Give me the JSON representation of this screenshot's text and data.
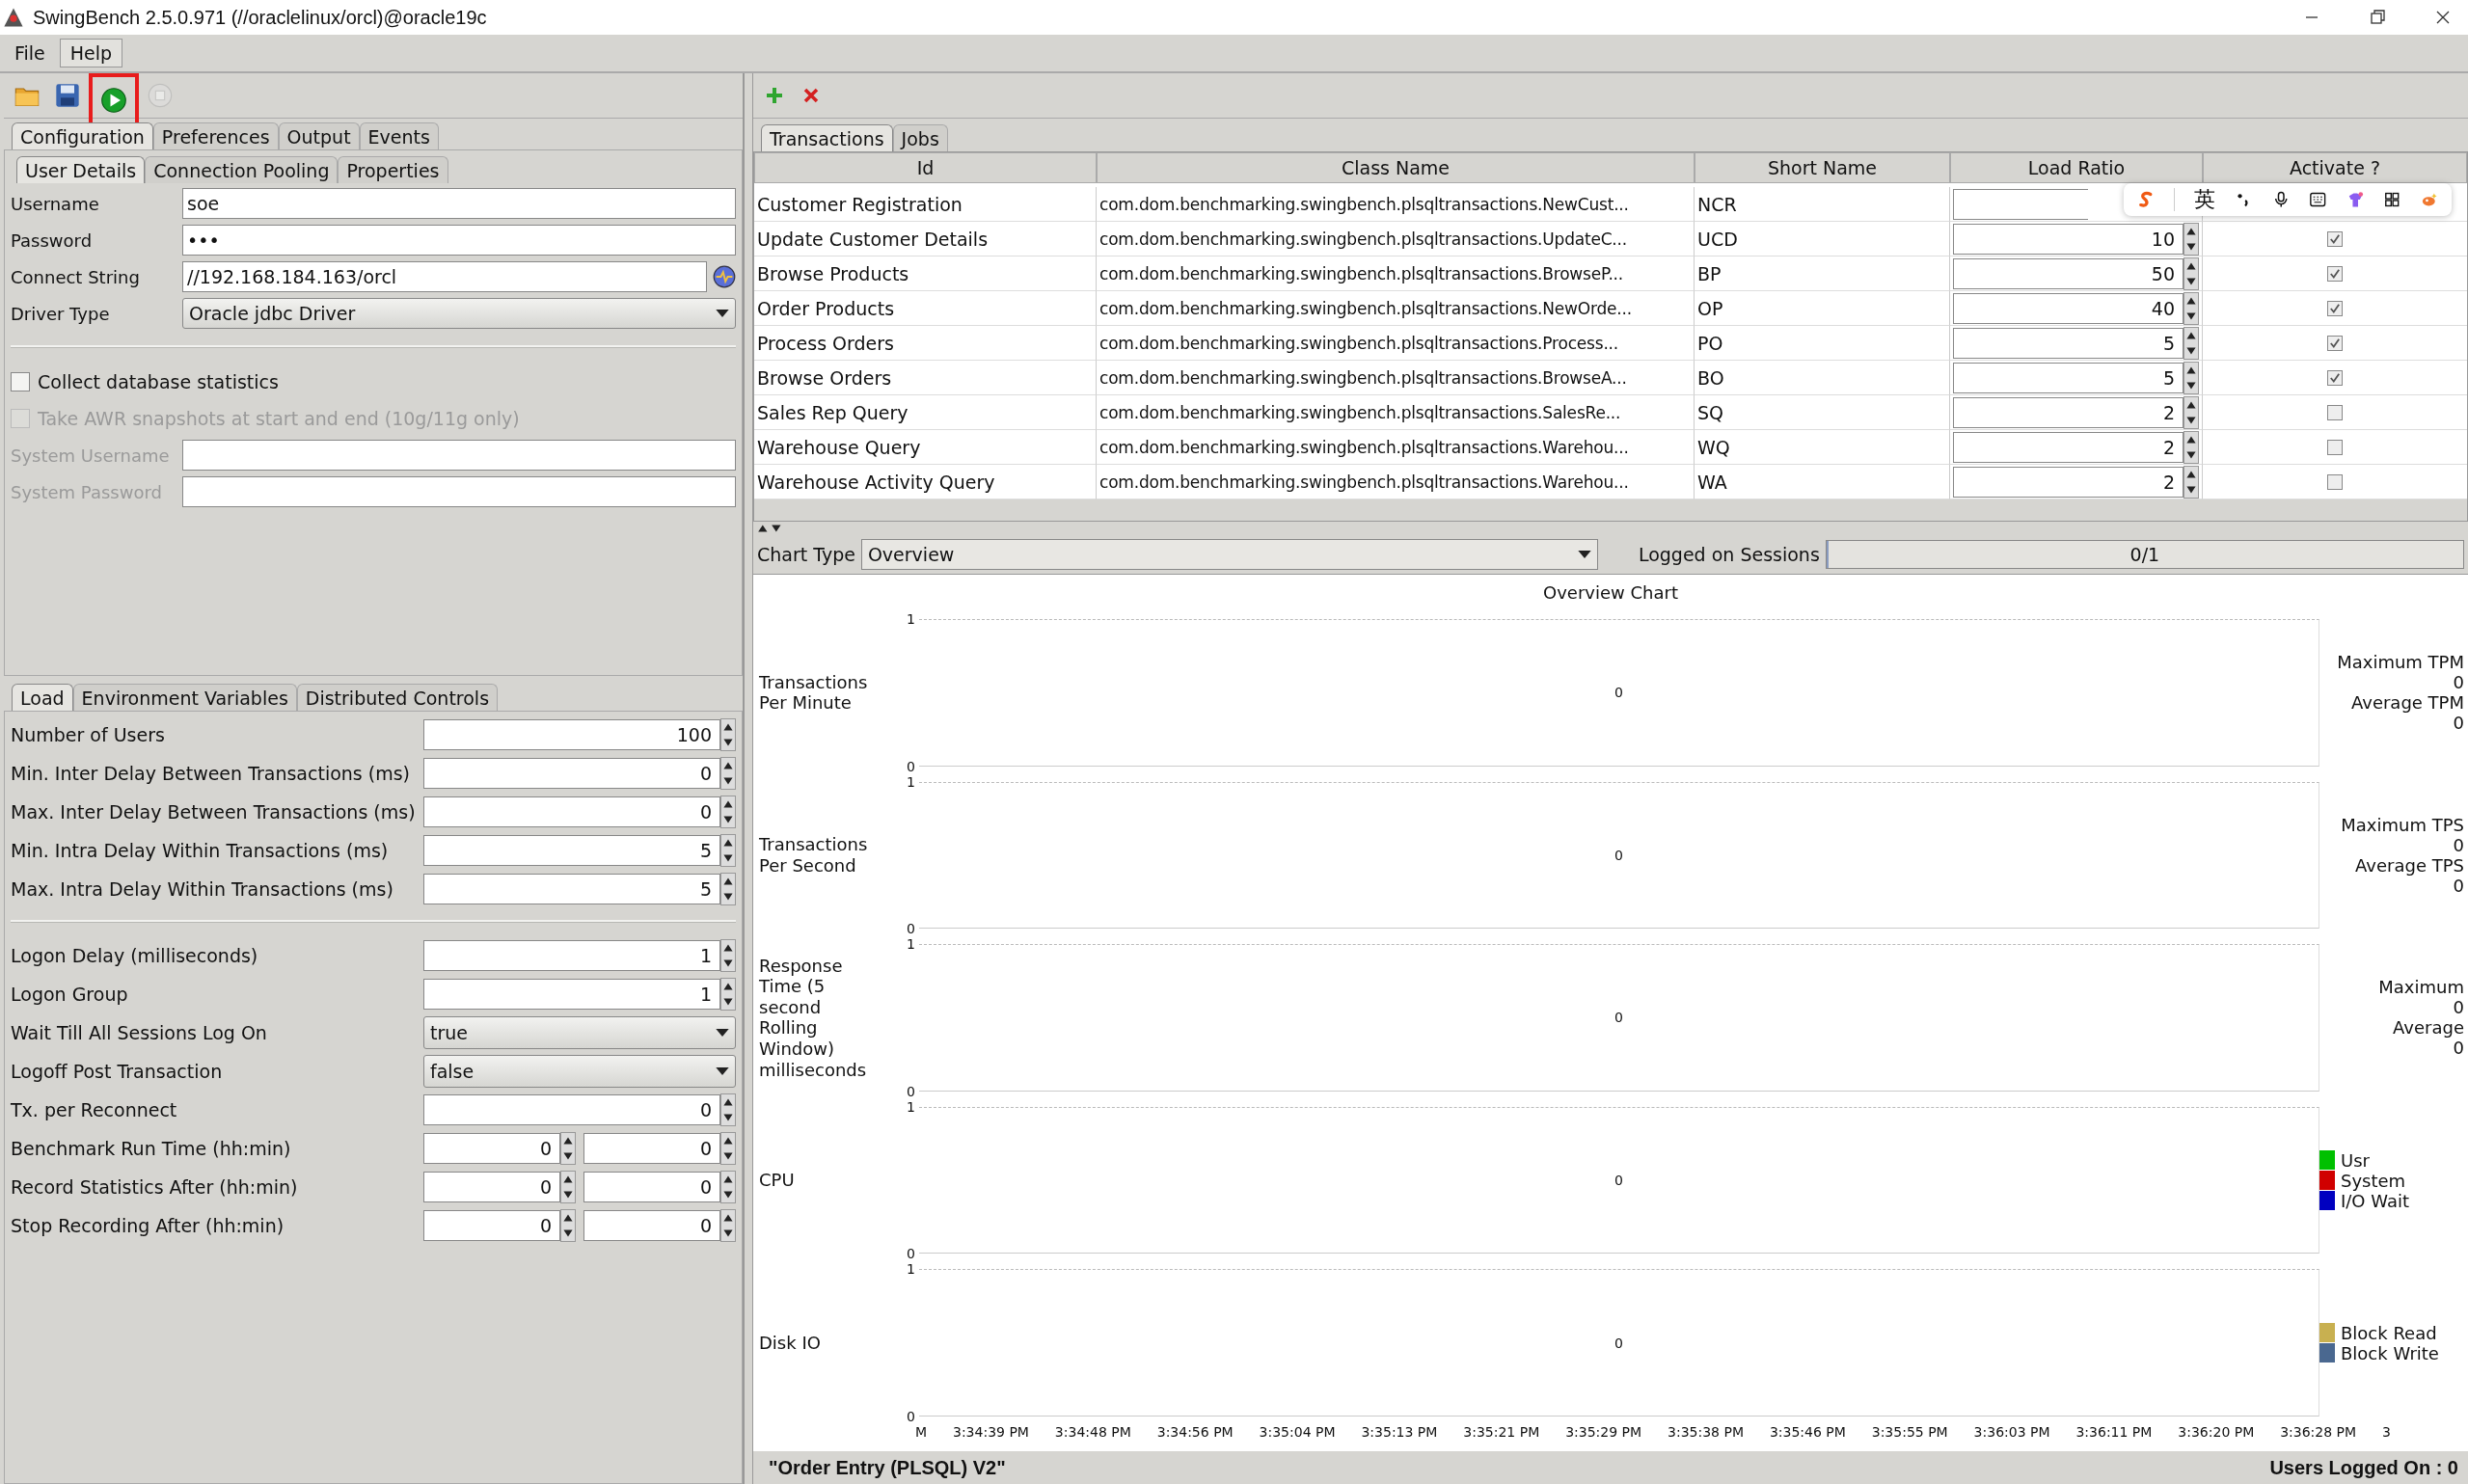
{
  "window": {
    "title": "SwingBench 2.5.0.971  (//oraclelinux/orcl)@oracle19c"
  },
  "menu": [
    {
      "label": "File",
      "selected": false
    },
    {
      "label": "Help",
      "selected": true
    }
  ],
  "toolbar": [
    {
      "kind": "open",
      "highlighted": false,
      "disabled": false
    },
    {
      "kind": "save",
      "highlighted": false,
      "disabled": false
    },
    {
      "kind": "run",
      "highlighted": true,
      "disabled": false
    },
    {
      "kind": "stop",
      "highlighted": false,
      "disabled": true
    }
  ],
  "config_tabs": [
    {
      "label": "Configuration",
      "selected": true
    },
    {
      "label": "Preferences",
      "selected": false
    },
    {
      "label": "Output",
      "selected": false
    },
    {
      "label": "Events",
      "selected": false
    }
  ],
  "detail_tabs": [
    {
      "label": "User Details",
      "selected": true
    },
    {
      "label": "Connection Pooling",
      "selected": false
    },
    {
      "label": "Properties",
      "selected": false
    }
  ],
  "user_fields": [
    {
      "label": "Username",
      "value": "soe",
      "kind": "text"
    },
    {
      "label": "Password",
      "value": "•••",
      "kind": "text"
    },
    {
      "label": "Connect String",
      "value": "//192.168.184.163/orcl",
      "kind": "connect"
    },
    {
      "label": "Driver Type",
      "value": "Oracle jdbc Driver",
      "kind": "select"
    }
  ],
  "options": [
    {
      "label": "Collect database statistics",
      "checked": false,
      "disabled": false
    },
    {
      "label": "Take AWR snapshots at start and end (10g/11g only)",
      "checked": false,
      "disabled": true
    }
  ],
  "system_fields": [
    {
      "label": "System Username",
      "disabled": true
    },
    {
      "label": "System Password",
      "disabled": true
    }
  ],
  "load_tabs": [
    {
      "label": "Load",
      "selected": true
    },
    {
      "label": "Environment Variables",
      "selected": false
    },
    {
      "label": "Distributed Controls",
      "selected": false
    }
  ],
  "load_settings": [
    {
      "label": "Number of Users",
      "kind": "spinner",
      "values": [
        "100"
      ]
    },
    {
      "label": "Min. Inter Delay Between Transactions (ms)",
      "kind": "spinner",
      "values": [
        "0"
      ]
    },
    {
      "label": "Max. Inter Delay Between Transactions (ms)",
      "kind": "spinner",
      "values": [
        "0"
      ]
    },
    {
      "label": "Min. Intra Delay Within Transactions (ms)",
      "kind": "spinner",
      "values": [
        "5"
      ]
    },
    {
      "label": "Max. Intra Delay Within Transactions (ms)",
      "kind": "spinner",
      "values": [
        "5"
      ]
    }
  ],
  "logon_settings": [
    {
      "label": "Logon Delay (milliseconds)",
      "kind": "spinner",
      "values": [
        "1"
      ]
    },
    {
      "label": "Logon Group",
      "kind": "spinner",
      "values": [
        "1"
      ]
    },
    {
      "label": "Wait Till All Sessions Log On",
      "kind": "select",
      "values": [
        "true"
      ]
    },
    {
      "label": "Logoff Post Transaction",
      "kind": "select",
      "values": [
        "false"
      ]
    },
    {
      "label": "Tx. per Reconnect",
      "kind": "spinner",
      "values": [
        "0"
      ]
    },
    {
      "label": "Benchmark Run Time (hh:min)",
      "kind": "spinner",
      "values": [
        "0",
        "0"
      ]
    },
    {
      "label": "Record Statistics After (hh:min)",
      "kind": "spinner",
      "values": [
        "0",
        "0"
      ]
    },
    {
      "label": "Stop Recording After (hh:min)",
      "kind": "spinner",
      "values": [
        "0",
        "0"
      ]
    }
  ],
  "transactions": {
    "tabs": [
      {
        "label": "Transactions",
        "selected": true
      },
      {
        "label": "Jobs",
        "selected": false
      }
    ],
    "columns": [
      "Id",
      "Class Name",
      "Short Name",
      "Load Ratio",
      "Activate ?"
    ],
    "rows": [
      {
        "id": "Customer Registration",
        "class_name": "com.dom.benchmarking.swingbench.plsqltransactions.NewCust...",
        "short_name": "NCR"
      },
      {
        "id": "Update Customer Details",
        "class_name": "com.dom.benchmarking.swingbench.plsqltransactions.UpdateC...",
        "short_name": "UCD",
        "load_ratio": "10",
        "active": true
      },
      {
        "id": "Browse Products",
        "class_name": "com.dom.benchmarking.swingbench.plsqltransactions.BrowseP...",
        "short_name": "BP",
        "load_ratio": "50",
        "active": true
      },
      {
        "id": "Order Products",
        "class_name": "com.dom.benchmarking.swingbench.plsqltransactions.NewOrde...",
        "short_name": "OP",
        "load_ratio": "40",
        "active": true
      },
      {
        "id": "Process Orders",
        "class_name": "com.dom.benchmarking.swingbench.plsqltransactions.Process...",
        "short_name": "PO",
        "load_ratio": "5",
        "active": true
      },
      {
        "id": "Browse Orders",
        "class_name": "com.dom.benchmarking.swingbench.plsqltransactions.BrowseA...",
        "short_name": "BO",
        "load_ratio": "5",
        "active": true
      },
      {
        "id": "Sales Rep Query",
        "class_name": "com.dom.benchmarking.swingbench.plsqltransactions.SalesRe...",
        "short_name": "SQ",
        "load_ratio": "2",
        "active": false
      },
      {
        "id": "Warehouse Query",
        "class_name": "com.dom.benchmarking.swingbench.plsqltransactions.Warehou...",
        "short_name": "WQ",
        "load_ratio": "2",
        "active": false
      },
      {
        "id": "Warehouse Activity Query",
        "class_name": "com.dom.benchmarking.swingbench.plsqltransactions.Warehou...",
        "short_name": "WA",
        "load_ratio": "2",
        "active": false
      }
    ]
  },
  "ime_toolbar": {
    "language": "英"
  },
  "chart_panel": {
    "chart_type_label": "Chart Type",
    "chart_type": "Overview",
    "sessions_label": "Logged on Sessions",
    "sessions": "0/1",
    "sessions_level": {
      "level": 0
    },
    "title": "Overview Chart",
    "strips": [
      {
        "label": "Transactions Per Minute",
        "y_max": "1",
        "y_min": "0",
        "value": "0",
        "legend": [
          {
            "text": "Maximum TPM"
          },
          {
            "text": "0"
          },
          {
            "text": "Average TPM"
          },
          {
            "text": "0"
          }
        ]
      },
      {
        "label": "Transactions Per Second",
        "y_max": "1",
        "y_min": "0",
        "value": "0",
        "legend": [
          {
            "text": "Maximum TPS"
          },
          {
            "text": "0"
          },
          {
            "text": "Average TPS"
          },
          {
            "text": "0"
          }
        ]
      },
      {
        "label": "Response Time (5 second Rolling Window) milliseconds",
        "y_max": "1",
        "y_min": "0",
        "value": "0",
        "legend": [
          {
            "text": "Maximum"
          },
          {
            "text": "0"
          },
          {
            "text": "Average"
          },
          {
            "text": "0"
          }
        ]
      },
      {
        "label": "CPU",
        "y_max": "1",
        "y_min": "0",
        "value": "0",
        "legend": [
          {
            "text": "Usr",
            "color": "#00c000"
          },
          {
            "text": "System",
            "color": "#d00000"
          },
          {
            "text": "I/O Wait",
            "color": "#0000c0"
          }
        ]
      },
      {
        "label": "Disk IO",
        "y_max": "1",
        "y_min": "0",
        "value": "0",
        "legend": [
          {
            "text": "Block Read",
            "color": "#c8b050"
          },
          {
            "text": "Block Write",
            "color": "#4a6890"
          }
        ]
      }
    ],
    "time_ticks": [
      "M",
      "3:34:39 PM",
      "3:34:48 PM",
      "3:34:56 PM",
      "3:35:04 PM",
      "3:35:13 PM",
      "3:35:21 PM",
      "3:35:29 PM",
      "3:35:38 PM",
      "3:35:46 PM",
      "3:35:55 PM",
      "3:36:03 PM",
      "3:36:11 PM",
      "3:36:20 PM",
      "3:36:28 PM",
      "3"
    ]
  },
  "status": {
    "benchmark": "\"Order Entry (PLSQL) V2\"",
    "users": "Users Logged On : 0"
  }
}
